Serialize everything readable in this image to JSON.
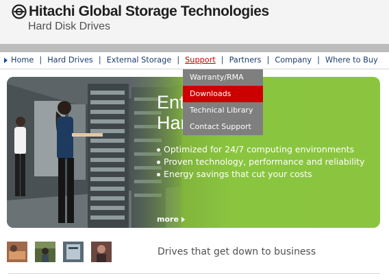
{
  "header": {
    "brand": "Hitachi Global Storage Technologies",
    "tagline": "Hard Disk Drives"
  },
  "nav": {
    "items": [
      {
        "label": "Home"
      },
      {
        "label": "Hard Drives"
      },
      {
        "label": "External Storage"
      },
      {
        "label": "Support",
        "active": true
      },
      {
        "label": "Partners"
      },
      {
        "label": "Company"
      },
      {
        "label": "Where to Buy"
      }
    ],
    "separator": "|"
  },
  "support_menu": {
    "items": [
      {
        "label": "Warranty/RMA"
      },
      {
        "label": "Downloads",
        "selected": true
      },
      {
        "label": "Technical Library"
      },
      {
        "label": "Contact Support"
      }
    ]
  },
  "hero": {
    "title_line1": "Ent",
    "title_line2": "Hard Drives",
    "bullets": [
      "Optimized for 24/7 computing environments",
      "Proven technology, performance and reliability",
      "Energy savings that cut your costs"
    ],
    "more_label": "more"
  },
  "footer": {
    "tagline": "Drives that get down to business"
  },
  "colors": {
    "accent_red": "#cc0000",
    "nav_text": "#1a3b6b",
    "hero_green": "#8ac540",
    "menu_gray": "#7f7f7f"
  },
  "icons": [
    "hitachi-logo-icon",
    "nav-arrow-icon",
    "more-arrow-icon"
  ]
}
